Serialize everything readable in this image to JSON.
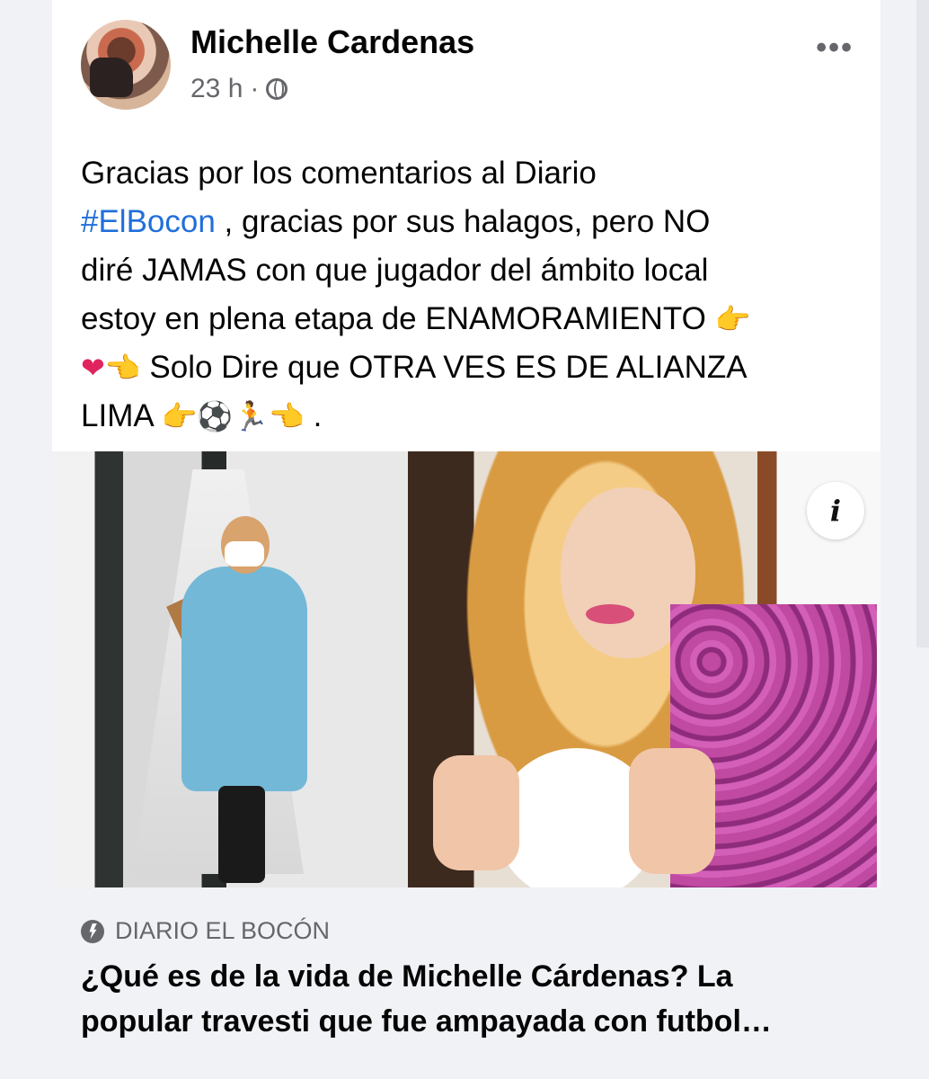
{
  "post": {
    "author": "Michelle Cardenas",
    "time": "23 h",
    "separator": "·",
    "privacy_icon": "globe-icon",
    "more_label": "•••",
    "text_lines": [
      "Gracias por los comentarios al Diario",
      "#ElBocon",
      " , gracias por sus halagos,  pero NO",
      "diré JAMAS con que jugador del ámbito local",
      "estoy en plena etapa de ENAMORAMIENTO ",
      "👉",
      "❤",
      "👈",
      " Solo Dire  que OTRA VES ES DE ALIANZA",
      "LIMA ",
      "👉⚽🏃👈",
      " ."
    ]
  },
  "link_preview": {
    "info_label": "i",
    "source_icon": "lightning-icon",
    "source": "DIARIO EL BOCÓN",
    "headline_line_1": "¿Qué es de la vida de Michelle Cárdenas? La",
    "headline_line_2": "popular travesti que fue ampayada con futbol…"
  },
  "colors": {
    "hashtag": "#216fdb",
    "meta_gray": "#65676b",
    "preview_bg": "#f0f2f5"
  }
}
